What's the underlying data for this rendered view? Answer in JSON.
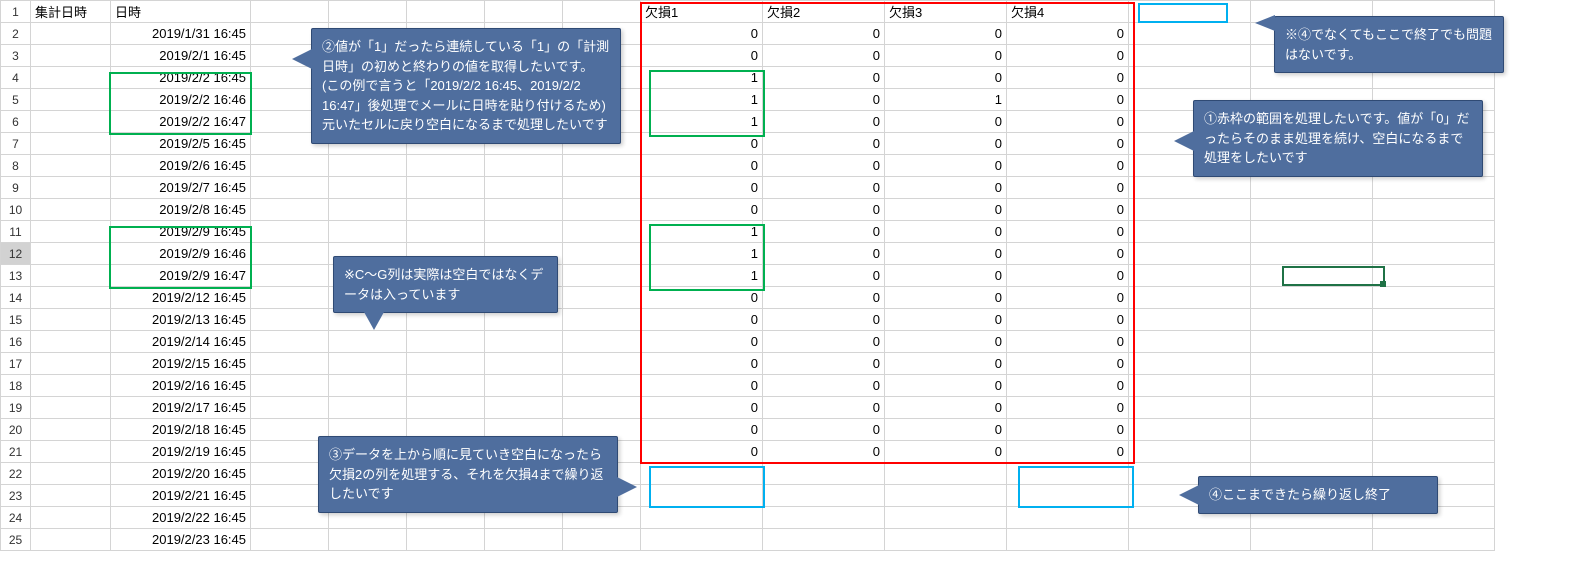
{
  "headers": {
    "colA": "集計日時",
    "colB": "日時",
    "colH": "欠損1",
    "colI": "欠損2",
    "colJ": "欠損3",
    "colK": "欠損4"
  },
  "rows": [
    {
      "n": "1",
      "b": ""
    },
    {
      "n": "2",
      "b": "2019/1/31 16:45",
      "h": "0",
      "i": "0",
      "j": "0",
      "k": "0"
    },
    {
      "n": "3",
      "b": "2019/2/1 16:45",
      "h": "0",
      "i": "0",
      "j": "0",
      "k": "0"
    },
    {
      "n": "4",
      "b": "2019/2/2 16:45",
      "h": "1",
      "i": "0",
      "j": "0",
      "k": "0"
    },
    {
      "n": "5",
      "b": "2019/2/2 16:46",
      "h": "1",
      "i": "0",
      "j": "1",
      "k": "0"
    },
    {
      "n": "6",
      "b": "2019/2/2 16:47",
      "h": "1",
      "i": "0",
      "j": "0",
      "k": "0"
    },
    {
      "n": "7",
      "b": "2019/2/5 16:45",
      "h": "0",
      "i": "0",
      "j": "0",
      "k": "0"
    },
    {
      "n": "8",
      "b": "2019/2/6 16:45",
      "h": "0",
      "i": "0",
      "j": "0",
      "k": "0"
    },
    {
      "n": "9",
      "b": "2019/2/7 16:45",
      "h": "0",
      "i": "0",
      "j": "0",
      "k": "0"
    },
    {
      "n": "10",
      "b": "2019/2/8 16:45",
      "h": "0",
      "i": "0",
      "j": "0",
      "k": "0"
    },
    {
      "n": "11",
      "b": "2019/2/9 16:45",
      "h": "1",
      "i": "0",
      "j": "0",
      "k": "0"
    },
    {
      "n": "12",
      "b": "2019/2/9 16:46",
      "h": "1",
      "i": "0",
      "j": "0",
      "k": "0"
    },
    {
      "n": "13",
      "b": "2019/2/9 16:47",
      "h": "1",
      "i": "0",
      "j": "0",
      "k": "0"
    },
    {
      "n": "14",
      "b": "2019/2/12 16:45",
      "h": "0",
      "i": "0",
      "j": "0",
      "k": "0"
    },
    {
      "n": "15",
      "b": "2019/2/13 16:45",
      "h": "0",
      "i": "0",
      "j": "0",
      "k": "0"
    },
    {
      "n": "16",
      "b": "2019/2/14 16:45",
      "h": "0",
      "i": "0",
      "j": "0",
      "k": "0"
    },
    {
      "n": "17",
      "b": "2019/2/15 16:45",
      "h": "0",
      "i": "0",
      "j": "0",
      "k": "0"
    },
    {
      "n": "18",
      "b": "2019/2/16 16:45",
      "h": "0",
      "i": "0",
      "j": "0",
      "k": "0"
    },
    {
      "n": "19",
      "b": "2019/2/17 16:45",
      "h": "0",
      "i": "0",
      "j": "0",
      "k": "0"
    },
    {
      "n": "20",
      "b": "2019/2/18 16:45",
      "h": "0",
      "i": "0",
      "j": "0",
      "k": "0"
    },
    {
      "n": "21",
      "b": "2019/2/19 16:45",
      "h": "0",
      "i": "0",
      "j": "0",
      "k": "0"
    },
    {
      "n": "22",
      "b": "2019/2/20 16:45",
      "h": "",
      "i": "",
      "j": "",
      "k": ""
    },
    {
      "n": "23",
      "b": "2019/2/21 16:45",
      "h": "",
      "i": "",
      "j": "",
      "k": ""
    },
    {
      "n": "24",
      "b": "2019/2/22 16:45",
      "h": "",
      "i": "",
      "j": "",
      "k": ""
    },
    {
      "n": "25",
      "b": "2019/2/23 16:45",
      "h": "",
      "i": "",
      "j": "",
      "k": ""
    }
  ],
  "callouts": {
    "c2": "②値が「1」だったら連続している「1」の「計測日時」の初めと終わりの値を取得したいです。(この例で言うと「2019/2/2 16:45、2019/2/2 16:47」後処理でメールに日時を貼り付けるため)元いたセルに戻り空白になるまで処理したいです",
    "cNote": "※C～G列は実際は空白ではなくデータは入っています",
    "c3": "③データを上から順に見ていき空白になったら欠損2の列を処理する、それを欠損4まで繰り返したいです",
    "cTop": "※④でなくてもここで終了でも問題はないです。",
    "c1": "①赤枠の範囲を処理したいです。値が「0」だったらそのまま処理を続け、空白になるまで処理をしたいです",
    "c4": "④ここまできたら繰り返し終了"
  }
}
